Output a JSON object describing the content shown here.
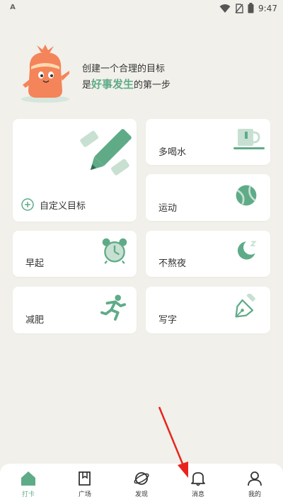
{
  "status_bar": {
    "time": "9:47",
    "left_icon": "A"
  },
  "hero": {
    "line1": "创建一个合理的目标",
    "line2_prefix": "是",
    "line2_highlight": "好事发生",
    "line2_suffix": "的第一步"
  },
  "cards": {
    "custom": {
      "label": "自定义目标",
      "icon": "pencil-icon"
    },
    "drink_water": {
      "label": "多喝水",
      "icon": "cup-icon"
    },
    "exercise": {
      "label": "运动",
      "icon": "ball-icon"
    },
    "early_rise": {
      "label": "早起",
      "icon": "alarm-clock-icon"
    },
    "no_late_night": {
      "label": "不熬夜",
      "icon": "moon-icon"
    },
    "lose_weight": {
      "label": "减肥",
      "icon": "running-person-icon"
    },
    "writing": {
      "label": "写字",
      "icon": "fountain-pen-icon"
    }
  },
  "tabs": [
    {
      "label": "打卡",
      "icon": "home-icon",
      "active": true
    },
    {
      "label": "广场",
      "icon": "book-icon",
      "active": false
    },
    {
      "label": "发现",
      "icon": "planet-icon",
      "active": false
    },
    {
      "label": "消息",
      "icon": "bell-icon",
      "active": false
    },
    {
      "label": "我的",
      "icon": "person-icon",
      "active": false
    }
  ],
  "colors": {
    "accent": "#5fab88",
    "background": "#f1f0ea",
    "mascot": "#f4845a",
    "annotation": "#e8231e"
  }
}
